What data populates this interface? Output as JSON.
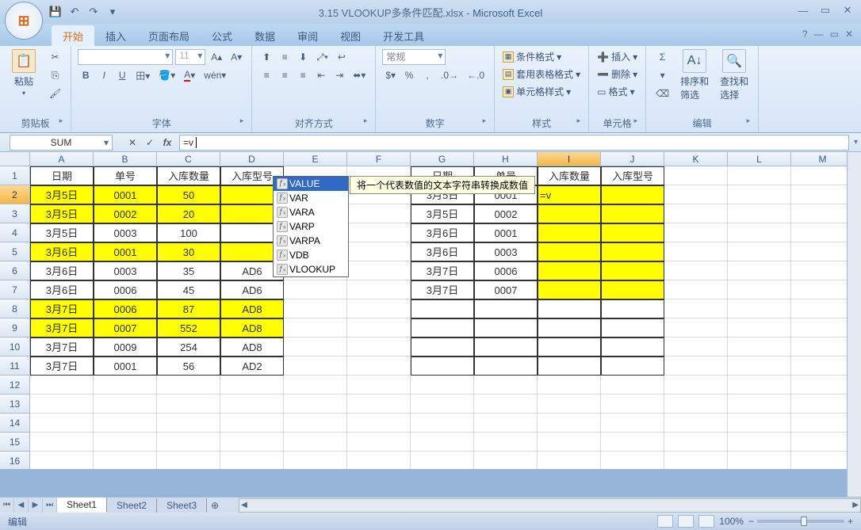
{
  "title": {
    "file": "3.15 VLOOKUP多条件匹配.xlsx",
    "app": "Microsoft Excel"
  },
  "tabs": [
    "开始",
    "插入",
    "页面布局",
    "公式",
    "数据",
    "审阅",
    "视图",
    "开发工具"
  ],
  "active_tab": 0,
  "ribbon": {
    "clipboard": {
      "paste": "粘贴",
      "label": "剪贴板"
    },
    "font": {
      "size": "11",
      "label": "字体",
      "bold": "B",
      "italic": "I",
      "underline": "U"
    },
    "align": {
      "label": "对齐方式"
    },
    "number": {
      "format": "常规",
      "label": "数字",
      "pct": "%",
      "comma": ","
    },
    "styles": {
      "cond": "条件格式",
      "table": "套用表格格式",
      "cell": "单元格样式",
      "label": "样式"
    },
    "cells": {
      "insert": "插入",
      "delete": "删除",
      "format": "格式",
      "label": "单元格"
    },
    "editing": {
      "sort": "排序和\n筛选",
      "find": "查找和\n选择",
      "label": "编辑",
      "sigma": "Σ"
    }
  },
  "formula_bar": {
    "name": "SUM",
    "formula": "=v"
  },
  "cols": [
    "A",
    "B",
    "C",
    "D",
    "E",
    "F",
    "G",
    "H",
    "I",
    "J",
    "K",
    "L",
    "M"
  ],
  "active_col_idx": 8,
  "row_count": 16,
  "active_row": 2,
  "headers_left": [
    "日期",
    "单号",
    "入库数量",
    "入库型号"
  ],
  "headers_right": [
    "日期",
    "单号",
    "入库数量",
    "入库型号"
  ],
  "data_left": [
    {
      "d": "3月5日",
      "n": "0001",
      "q": "50",
      "m": "",
      "yl": true
    },
    {
      "d": "3月5日",
      "n": "0002",
      "q": "20",
      "m": "",
      "yl": true
    },
    {
      "d": "3月5日",
      "n": "0003",
      "q": "100",
      "m": "",
      "yl": false
    },
    {
      "d": "3月6日",
      "n": "0001",
      "q": "30",
      "m": "",
      "yl": true
    },
    {
      "d": "3月6日",
      "n": "0003",
      "q": "35",
      "m": "AD6",
      "yl": false
    },
    {
      "d": "3月6日",
      "n": "0006",
      "q": "45",
      "m": "AD6",
      "yl": false
    },
    {
      "d": "3月7日",
      "n": "0006",
      "q": "87",
      "m": "AD8",
      "yl": true
    },
    {
      "d": "3月7日",
      "n": "0007",
      "q": "552",
      "m": "AD8",
      "yl": true
    },
    {
      "d": "3月7日",
      "n": "0009",
      "q": "254",
      "m": "AD8",
      "yl": false
    },
    {
      "d": "3月7日",
      "n": "0001",
      "q": "56",
      "m": "AD2",
      "yl": false
    }
  ],
  "data_right": [
    {
      "d": "3月5日",
      "n": "0001",
      "q": "=v",
      "m": ""
    },
    {
      "d": "3月5日",
      "n": "0002",
      "q": "",
      "m": ""
    },
    {
      "d": "3月6日",
      "n": "0001",
      "q": "",
      "m": ""
    },
    {
      "d": "3月6日",
      "n": "0003",
      "q": "",
      "m": ""
    },
    {
      "d": "3月7日",
      "n": "0006",
      "q": "",
      "m": ""
    },
    {
      "d": "3月7日",
      "n": "0007",
      "q": "",
      "m": ""
    }
  ],
  "autocomplete": {
    "items": [
      "VALUE",
      "VAR",
      "VARA",
      "VARP",
      "VARPA",
      "VDB",
      "VLOOKUP"
    ],
    "selected": 0,
    "tooltip": "将一个代表数值的文本字符串转换成数值"
  },
  "sheets": [
    "Sheet1",
    "Sheet2",
    "Sheet3"
  ],
  "active_sheet": 0,
  "status": {
    "mode": "编辑",
    "zoom": "100%"
  }
}
